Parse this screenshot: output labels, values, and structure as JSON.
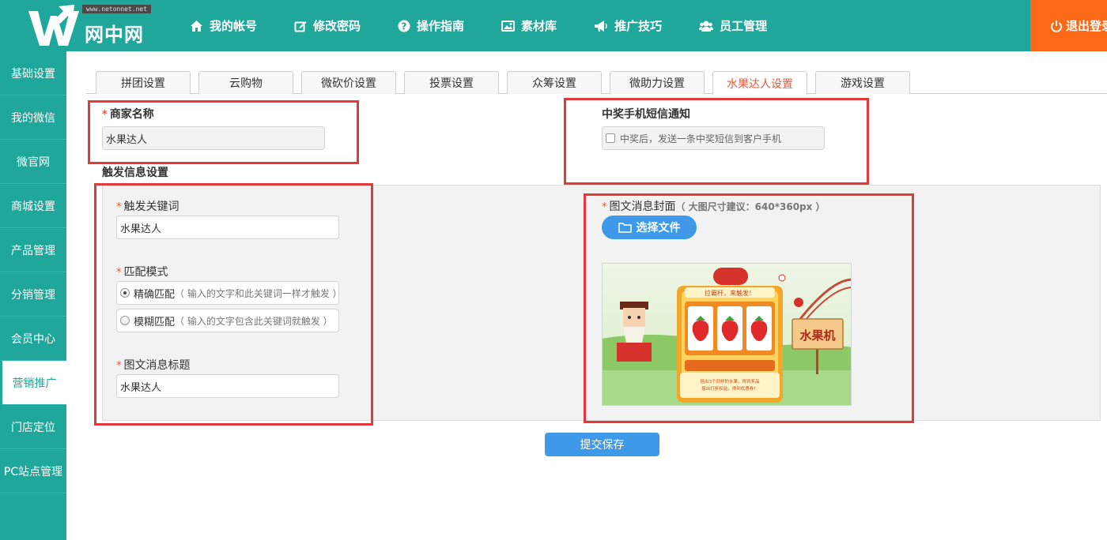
{
  "brand": {
    "url": "www.netonnet.net",
    "name": "网中网"
  },
  "nav": [
    {
      "label": "我的帐号",
      "icon": "home-icon"
    },
    {
      "label": "修改密码",
      "icon": "edit-icon"
    },
    {
      "label": "操作指南",
      "icon": "question-icon"
    },
    {
      "label": "素材库",
      "icon": "image-icon"
    },
    {
      "label": "推广技巧",
      "icon": "bullhorn-icon"
    },
    {
      "label": "员工管理",
      "icon": "users-icon"
    }
  ],
  "logout_label": "退出登录",
  "sidebar": [
    {
      "label": "基础设置"
    },
    {
      "label": "我的微信"
    },
    {
      "label": "微官网"
    },
    {
      "label": "商城设置"
    },
    {
      "label": "产品管理"
    },
    {
      "label": "分销管理"
    },
    {
      "label": "会员中心"
    },
    {
      "label": "营销推广",
      "active": true
    },
    {
      "label": "门店定位"
    },
    {
      "label": "PC站点管理"
    }
  ],
  "tabs": [
    {
      "label": "拼团设置"
    },
    {
      "label": "云购物"
    },
    {
      "label": "微砍价设置"
    },
    {
      "label": "投票设置"
    },
    {
      "label": "众筹设置"
    },
    {
      "label": "微助力设置"
    },
    {
      "label": "水果达人设置",
      "active": true
    },
    {
      "label": "游戏设置"
    }
  ],
  "form": {
    "required_mark": "*",
    "merchant_label": "商家名称",
    "merchant_value": "水果达人",
    "sms_label": "中奖手机短信通知",
    "sms_checkbox_label": "中奖后，发送一条中奖短信到客户手机",
    "trigger_section_title": "触发信息设置",
    "keyword_label": "触发关键词",
    "keyword_value": "水果达人",
    "match_label": "匹配模式",
    "match_exact_label": "精确匹配",
    "match_exact_hint": "（ 输入的文字和此关键词一样才触发 ）",
    "match_fuzzy_label": "模糊匹配",
    "match_fuzzy_hint": "（ 输入的文字包含此关键词就触发 ）",
    "title_label": "图文消息标题",
    "title_value": "水果达人",
    "cover_label": "图文消息封面",
    "cover_hint": "（ 大图尺寸建议：640*360px ）",
    "choose_file_label": "选择文件",
    "submit_label": "提交保存"
  },
  "preview": {
    "banner_top": "拉霸杆，来触发！",
    "sign_text": "水果机",
    "footer_line1": "摇出3个同样的水果，得到奖品",
    "footer_line2": "摇出打折权益，得到优惠券！"
  },
  "colors": {
    "header": "#1fa79b",
    "logout": "#fd6a17",
    "accent_red": "#e9573f",
    "button_blue": "#3e9ae8",
    "highlight_box": "#e23a3a"
  }
}
